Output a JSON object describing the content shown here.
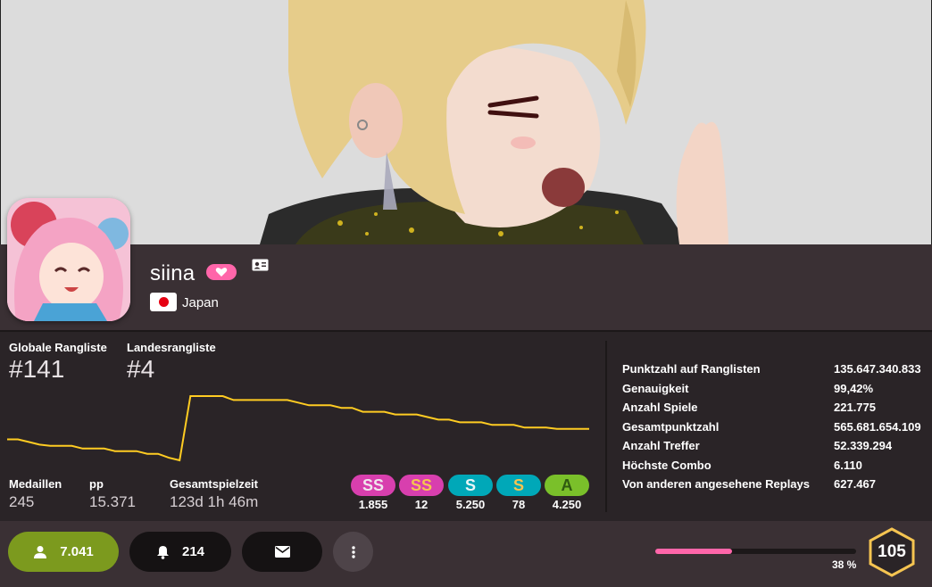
{
  "profile": {
    "username": "siina",
    "country": "Japan"
  },
  "ranks": {
    "global_label": "Globale Rangliste",
    "global_value": "#141",
    "country_label": "Landesrangliste",
    "country_value": "#4"
  },
  "summary": {
    "medals_label": "Medaillen",
    "medals_value": "245",
    "pp_label": "pp",
    "pp_value": "15.371",
    "playtime_label": "Gesamtspielzeit",
    "playtime_value": "123d 1h 46m"
  },
  "grades": [
    {
      "grade": "SS",
      "count": "1.855",
      "bg": "#d83fae",
      "fg": "#f0e6ee"
    },
    {
      "grade": "SS",
      "count": "12",
      "bg": "#d83fae",
      "fg": "#f5c451"
    },
    {
      "grade": "S",
      "count": "5.250",
      "bg": "#00a8b8",
      "fg": "#eaf6f7"
    },
    {
      "grade": "S",
      "count": "78",
      "bg": "#00a8b8",
      "fg": "#f5c451"
    },
    {
      "grade": "A",
      "count": "4.250",
      "bg": "#7ac02a",
      "fg": "#2f5a10"
    }
  ],
  "details": [
    {
      "label": "Punktzahl auf Ranglisten",
      "value": "135.647.340.833"
    },
    {
      "label": "Genauigkeit",
      "value": "99,42%"
    },
    {
      "label": "Anzahl Spiele",
      "value": "221.775"
    },
    {
      "label": "Gesamtpunktzahl",
      "value": "565.681.654.109"
    },
    {
      "label": "Anzahl Treffer",
      "value": "52.339.294"
    },
    {
      "label": "Höchste Combo",
      "value": "6.110"
    },
    {
      "label": "Von anderen angesehene Replays",
      "value": "627.467"
    }
  ],
  "actions": {
    "friends_count": "7.041",
    "followers_count": "214"
  },
  "level": {
    "progress_percent": 38,
    "progress_label": "38 %",
    "value": "105"
  },
  "rank_history_ranks": [
    176,
    176,
    178,
    180,
    181,
    181,
    181,
    183,
    183,
    183,
    185,
    185,
    185,
    187,
    187,
    190,
    192,
    143,
    143,
    143,
    143,
    146,
    146,
    146,
    146,
    146,
    146,
    148,
    150,
    150,
    150,
    152,
    152,
    155,
    155,
    155,
    157,
    157,
    157,
    159,
    161,
    161,
    163,
    163,
    163,
    165,
    165,
    165,
    167,
    167,
    167,
    168,
    168,
    168,
    168
  ],
  "colors": {
    "accent_pink": "#ff66aa",
    "graph_line": "#ffcc22",
    "friend_button": "#7c9a1e"
  }
}
